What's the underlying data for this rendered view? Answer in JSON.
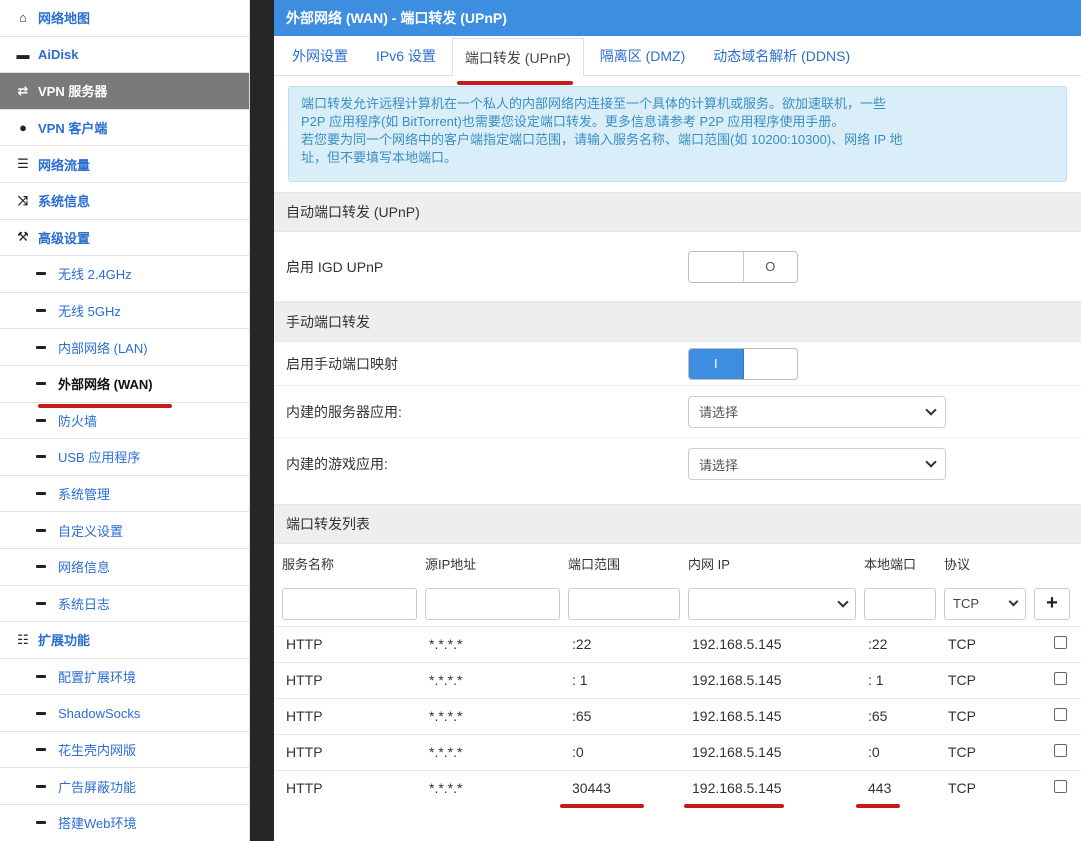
{
  "sidebar": {
    "top_items": [
      {
        "label": "网络地图",
        "icon": "home-icon"
      },
      {
        "label": "AiDisk",
        "icon": "disk-icon"
      },
      {
        "label": "VPN 服务器",
        "icon": "exchange-icon"
      },
      {
        "label": "VPN 客户端",
        "icon": "globe-icon"
      },
      {
        "label": "网络流量",
        "icon": "list-icon"
      },
      {
        "label": "系统信息",
        "icon": "shuffle-icon"
      },
      {
        "label": "高级设置",
        "icon": "wrench-icon"
      }
    ],
    "advanced_items": [
      "无线 2.4GHz",
      "无线 5GHz",
      "内部网络 (LAN)",
      "外部网络 (WAN)",
      "防火墙",
      "USB 应用程序",
      "系统管理",
      "自定义设置",
      "网络信息",
      "系统日志"
    ],
    "ext_title": "扩展功能",
    "ext_items": [
      "配置扩展环境",
      "ShadowSocks",
      "花生壳内网版",
      "广告屏蔽功能",
      "搭建Web环境"
    ]
  },
  "header": {
    "title": "外部网络 (WAN) - 端口转发 (UPnP)"
  },
  "tabs": [
    "外网设置",
    "IPv6 设置",
    "端口转发 (UPnP)",
    "隔离区 (DMZ)",
    "动态域名解析 (DDNS)"
  ],
  "info": {
    "line1": "端口转发允许远程计算机在一个私人的内部网络内连接至一个具体的计算机或服务。欲加速联机，一些",
    "line2": "P2P 应用程序(如 BitTorrent)也需要您设定端口转发。更多信息请参考 P2P 应用程序使用手册。",
    "line3": "若您要为同一个网络中的客户端指定端口范围，请输入服务名称、端口范围(如 10200:10300)、网络 IP 地",
    "line4": "址，但不要填写本地端口。"
  },
  "auto_section": {
    "title": "自动端口转发 (UPnP)",
    "igd_label": "启用 IGD UPnP",
    "igd_on_glyph": "",
    "igd_off_glyph": "O"
  },
  "manual_section": {
    "title": "手动端口转发",
    "enable_label": "启用手动端口映射",
    "enable_glyph": "I",
    "server_label": "内建的服务器应用:",
    "server_value": "请选择",
    "game_label": "内建的游戏应用:",
    "game_value": "请选择"
  },
  "list": {
    "title": "端口转发列表",
    "columns": [
      "服务名称",
      "源IP地址",
      "端口范围",
      "内网 IP",
      "本地端口",
      "协议"
    ],
    "protocol_default": "TCP",
    "add_label": "+",
    "rows": [
      {
        "name": "HTTP",
        "src": "*.*.*.*",
        "range": ":22",
        "ip": "192.168.5.145",
        "local": ":22",
        "proto": "TCP"
      },
      {
        "name": "HTTP",
        "src": "*.*.*.*",
        "range": ": 1",
        "ip": "192.168.5.145",
        "local": ": 1",
        "proto": "TCP"
      },
      {
        "name": "HTTP",
        "src": "*.*.*.*",
        "range": ":65",
        "ip": "192.168.5.145",
        "local": ":65",
        "proto": "TCP"
      },
      {
        "name": "HTTP",
        "src": "*.*.*.*",
        "range": ":0",
        "ip": "192.168.5.145",
        "local": ":0",
        "proto": "TCP"
      },
      {
        "name": "HTTP",
        "src": "*.*.*.*",
        "range": "30443",
        "ip": "192.168.5.145",
        "local": "443",
        "proto": "TCP"
      }
    ]
  },
  "colors": {
    "header_bg": "#3d8ee0",
    "link": "#2a6ed1",
    "highlight_red": "#c71a1a",
    "info_bg": "#d9eef9"
  }
}
